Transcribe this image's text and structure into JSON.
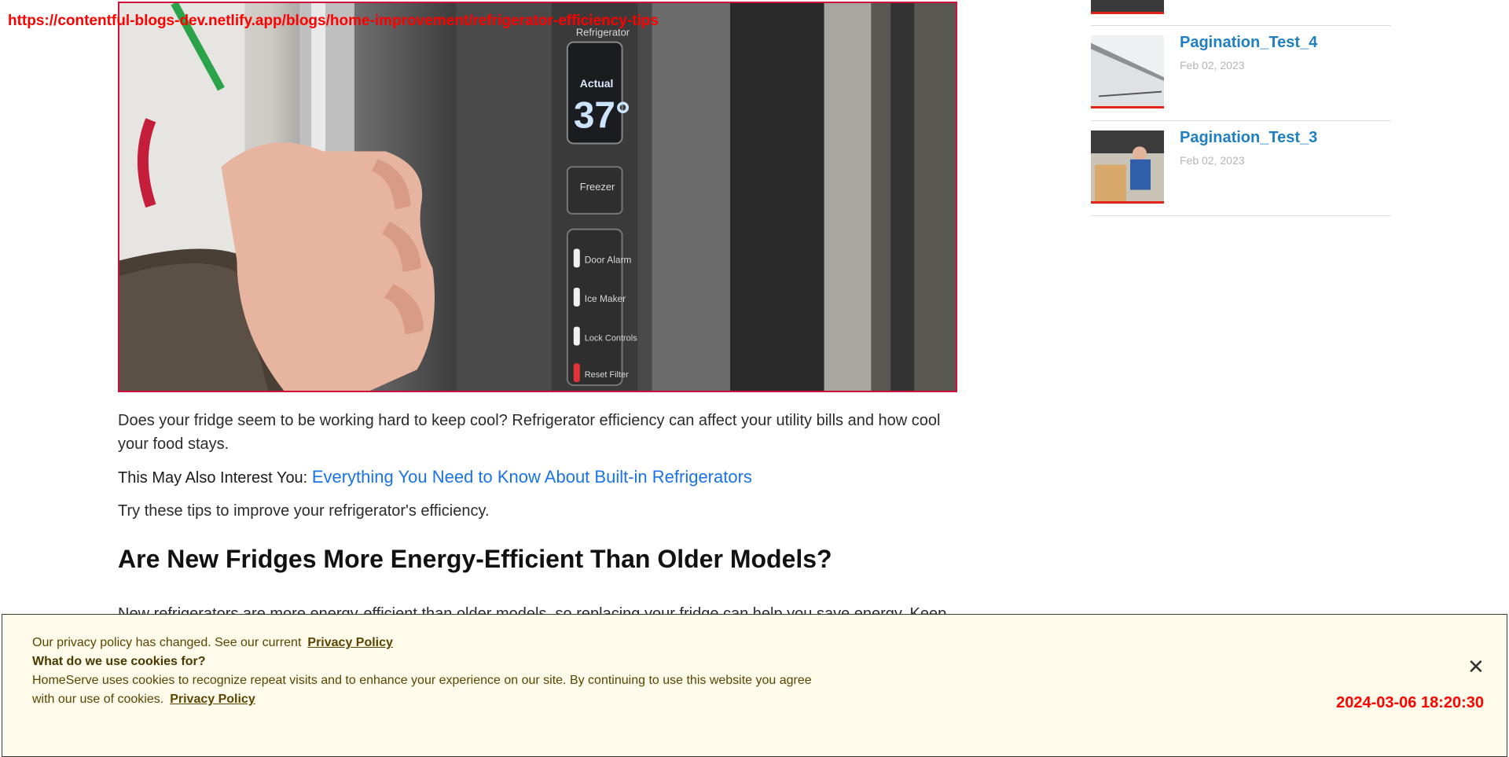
{
  "overlay": {
    "url": "https://contentful-blogs-dev.netlify.app/blogs/home-improvement/refrigerator-efficiency-tips",
    "timestamp": "2024-03-06 18:20:30"
  },
  "hero": {
    "panel_labels": [
      "Refrigerator",
      "Actual",
      "37°",
      "Freezer",
      "Door Alarm",
      "Ice Maker",
      "Lock Controls",
      "Reset Filter"
    ]
  },
  "article": {
    "intro": "Does your fridge seem to be working hard to keep cool? Refrigerator efficiency can affect your utility bills and how cool your food stays.",
    "interest_label": "This May Also Interest You:",
    "interest_link": "Everything You Need to Know About Built-in Refrigerators",
    "tips_intro": "Try these tips to improve your refrigerator's efficiency.",
    "heading": "Are New Fridges More Energy-Efficient Than Older Models?",
    "cut_paragraph": "New refrigerators are more energy-efficient than older models, so replacing your fridge can help you save energy. Keep"
  },
  "sidebar": {
    "items": [
      {
        "title": "Pagination_Test_4",
        "date": "Feb 02, 2023"
      },
      {
        "title": "Pagination_Test_3",
        "date": "Feb 02, 2023"
      }
    ]
  },
  "cookie": {
    "line1": "Our privacy policy has changed. See our current",
    "link1": "Privacy Policy",
    "heading": "What do we use cookies for?",
    "body": "HomeServe uses cookies to recognize repeat visits and to enhance your experience on our site. By continuing to use this website you agree with our use of cookies.",
    "link2": "Privacy Policy",
    "close": "✕"
  }
}
